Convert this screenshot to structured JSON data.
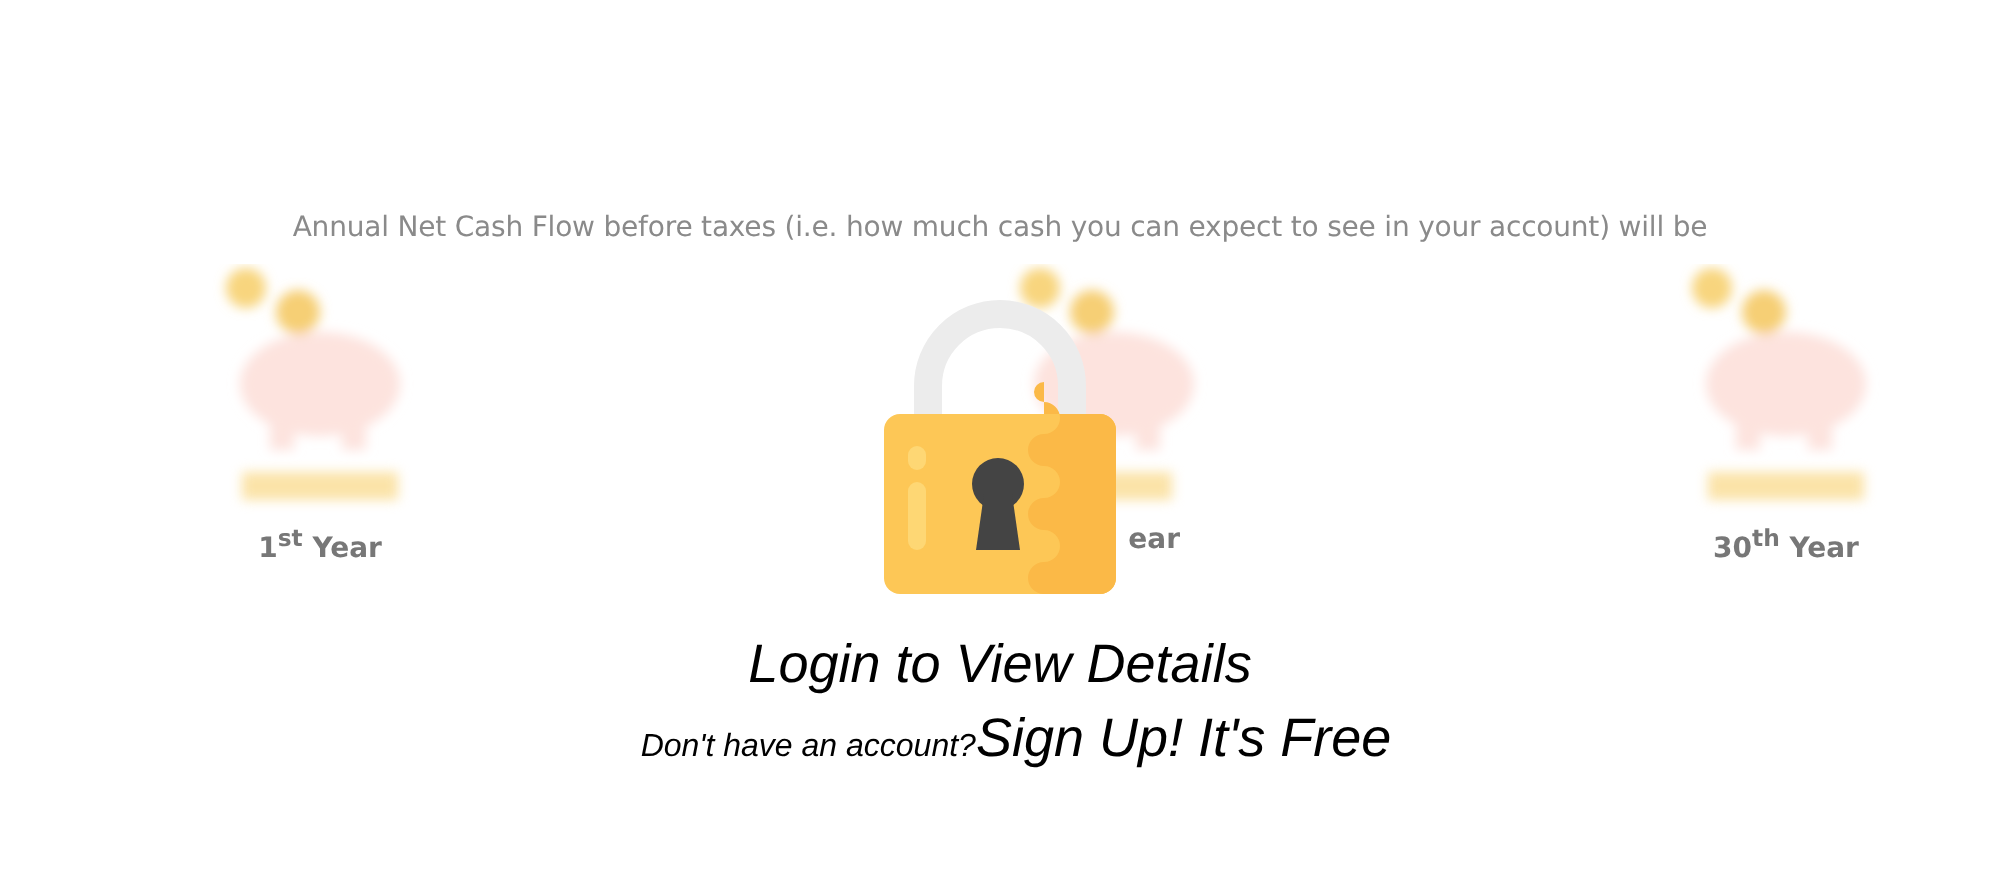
{
  "intro": "Annual Net Cash Flow before taxes (i.e. how much cash you can expect to see in your account) will be",
  "years": [
    {
      "label": "1$^{st}$ Year"
    },
    {
      "label": "ear"
    },
    {
      "label": "30$^{th}$ Year"
    }
  ],
  "login": {
    "title": "Login to View Details",
    "prompt": "Don't have an account?",
    "link": "Sign Up! It's Free"
  }
}
